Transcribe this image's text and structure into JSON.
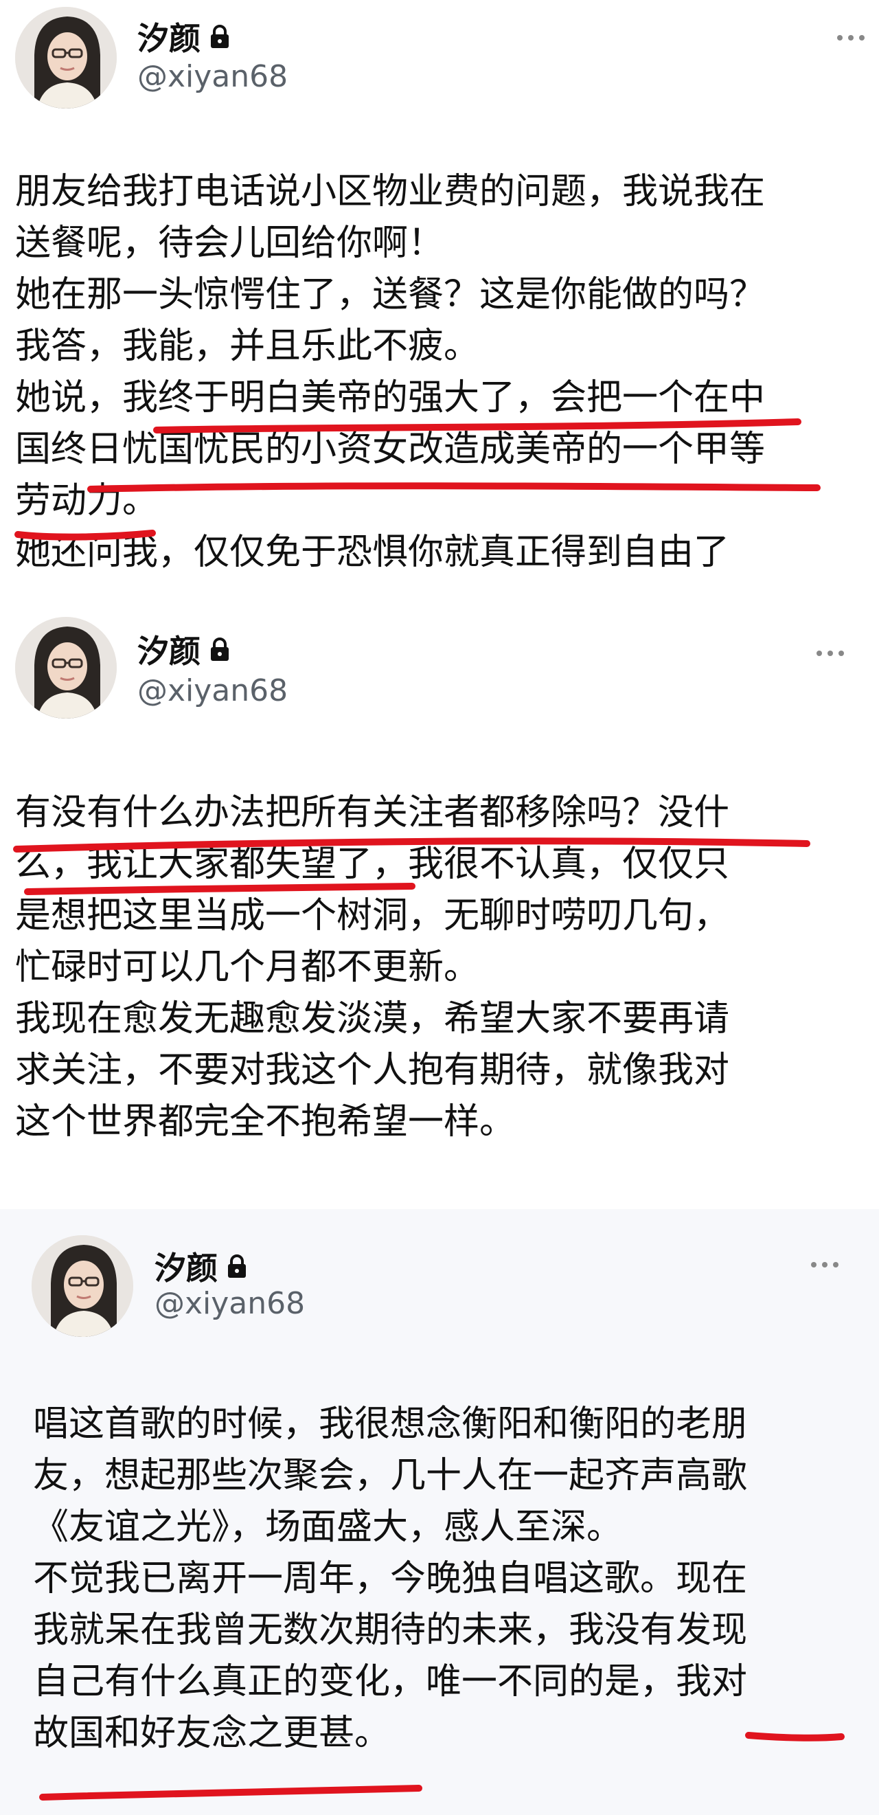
{
  "posts": [
    {
      "author": "汐颜",
      "handle": "@xiyan68",
      "lock_icon": "lock-icon",
      "more_icon": "more-horizontal-icon",
      "text": "朋友给我打电话说小区物业费的问题，我说我在\n送餐呢，待会儿回给你啊！\n她在那一头惊愕住了，送餐？这是你能做的吗？\n我答，我能，并且乐此不疲。\n她说，我终于明白美帝的强大了，会把一个在中\n国终日忧国忧民的小资女改造成美帝的一个甲等\n劳动力。\n她还问我，仅仅免于恐惧你就真正得到自由了"
    },
    {
      "author": "汐颜",
      "handle": "@xiyan68",
      "lock_icon": "lock-icon",
      "more_icon": "more-horizontal-icon",
      "text": "有没有什么办法把所有关注者都移除吗？没什\n么，我让大家都失望了，我很不认真，仅仅只\n是想把这里当成一个树洞，无聊时唠叨几句，\n忙碌时可以几个月都不更新。\n我现在愈发无趣愈发淡漠，希望大家不要再请\n求关注，不要对我这个人抱有期待，就像我对\n这个世界都完全不抱希望一样。"
    },
    {
      "author": "汐颜",
      "handle": "@xiyan68",
      "lock_icon": "lock-icon",
      "more_icon": "more-horizontal-icon",
      "text": "唱这首歌的时候，我很想念衡阳和衡阳的老朋\n友，想起那些次聚会，几十人在一起齐声高歌\n《友谊之光》，场面盛大，感人至深。\n不觉我已离开一周年，今晚独自唱这歌。现在\n我就呆在我曾无数次期待的未来，我没有发现\n自己有什么真正的变化，唯一不同的是，我对\n故国和好友念之更甚。"
    }
  ],
  "colors": {
    "underline": "#e0141e",
    "handle": "#5a6169",
    "text": "#111111",
    "post3_background": "#f7f8fb"
  }
}
